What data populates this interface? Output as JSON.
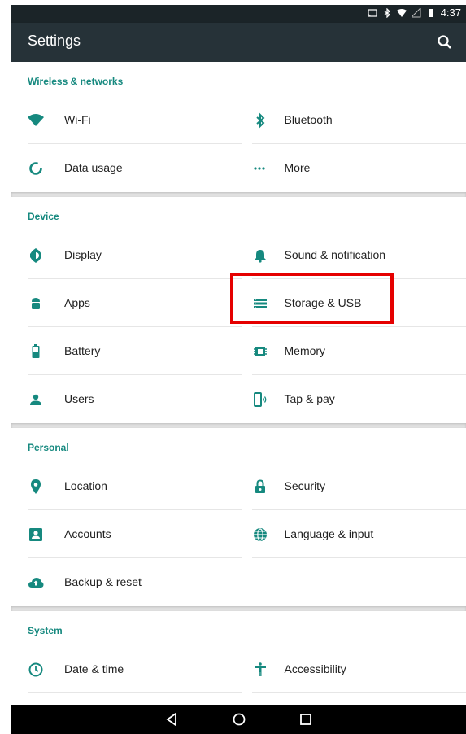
{
  "status": {
    "time": "4:37"
  },
  "appbar": {
    "title": "Settings",
    "search_icon": "search-icon"
  },
  "sections": {
    "wireless": {
      "title": "Wireless & networks",
      "items": {
        "wifi": "Wi-Fi",
        "bluetooth": "Bluetooth",
        "data_usage": "Data usage",
        "more": "More"
      }
    },
    "device": {
      "title": "Device",
      "items": {
        "display": "Display",
        "sound": "Sound & notification",
        "apps": "Apps",
        "storage": "Storage & USB",
        "battery": "Battery",
        "memory": "Memory",
        "users": "Users",
        "tap_pay": "Tap & pay"
      }
    },
    "personal": {
      "title": "Personal",
      "items": {
        "location": "Location",
        "security": "Security",
        "accounts": "Accounts",
        "language": "Language & input",
        "backup": "Backup & reset"
      }
    },
    "system": {
      "title": "System",
      "items": {
        "date_time": "Date & time",
        "accessibility": "Accessibility"
      }
    }
  },
  "colors": {
    "accent": "#16897f",
    "appbar": "#263238",
    "icon": "#16897f",
    "highlight": "#e50000"
  }
}
